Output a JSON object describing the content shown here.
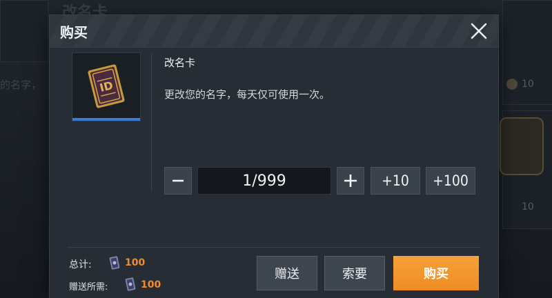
{
  "dialog": {
    "title": "购买",
    "close_icon": "close-icon"
  },
  "item": {
    "name": "改名卡",
    "description": "更改您的名字，每天仅可使用一次。",
    "icon": "rename-card-icon",
    "accent_color": "#3a7bd5"
  },
  "quantity": {
    "value": "1/999",
    "minus_label": "−",
    "plus_label": "+",
    "add10_label": "+10",
    "add100_label": "+100"
  },
  "totals": {
    "total_label": "总计:",
    "total_amount": "100",
    "gift_label": "赠送所需:",
    "gift_amount": "100",
    "currency_icon": "coupon-card-icon",
    "amount_color": "#f28a2e"
  },
  "actions": {
    "gift_label": "赠送",
    "request_label": "索要",
    "buy_label": "购买",
    "buy_color": "#f39a2d"
  },
  "background": {
    "title": "改名卡",
    "text": "的名字，",
    "prices": [
      "10",
      "10"
    ]
  }
}
